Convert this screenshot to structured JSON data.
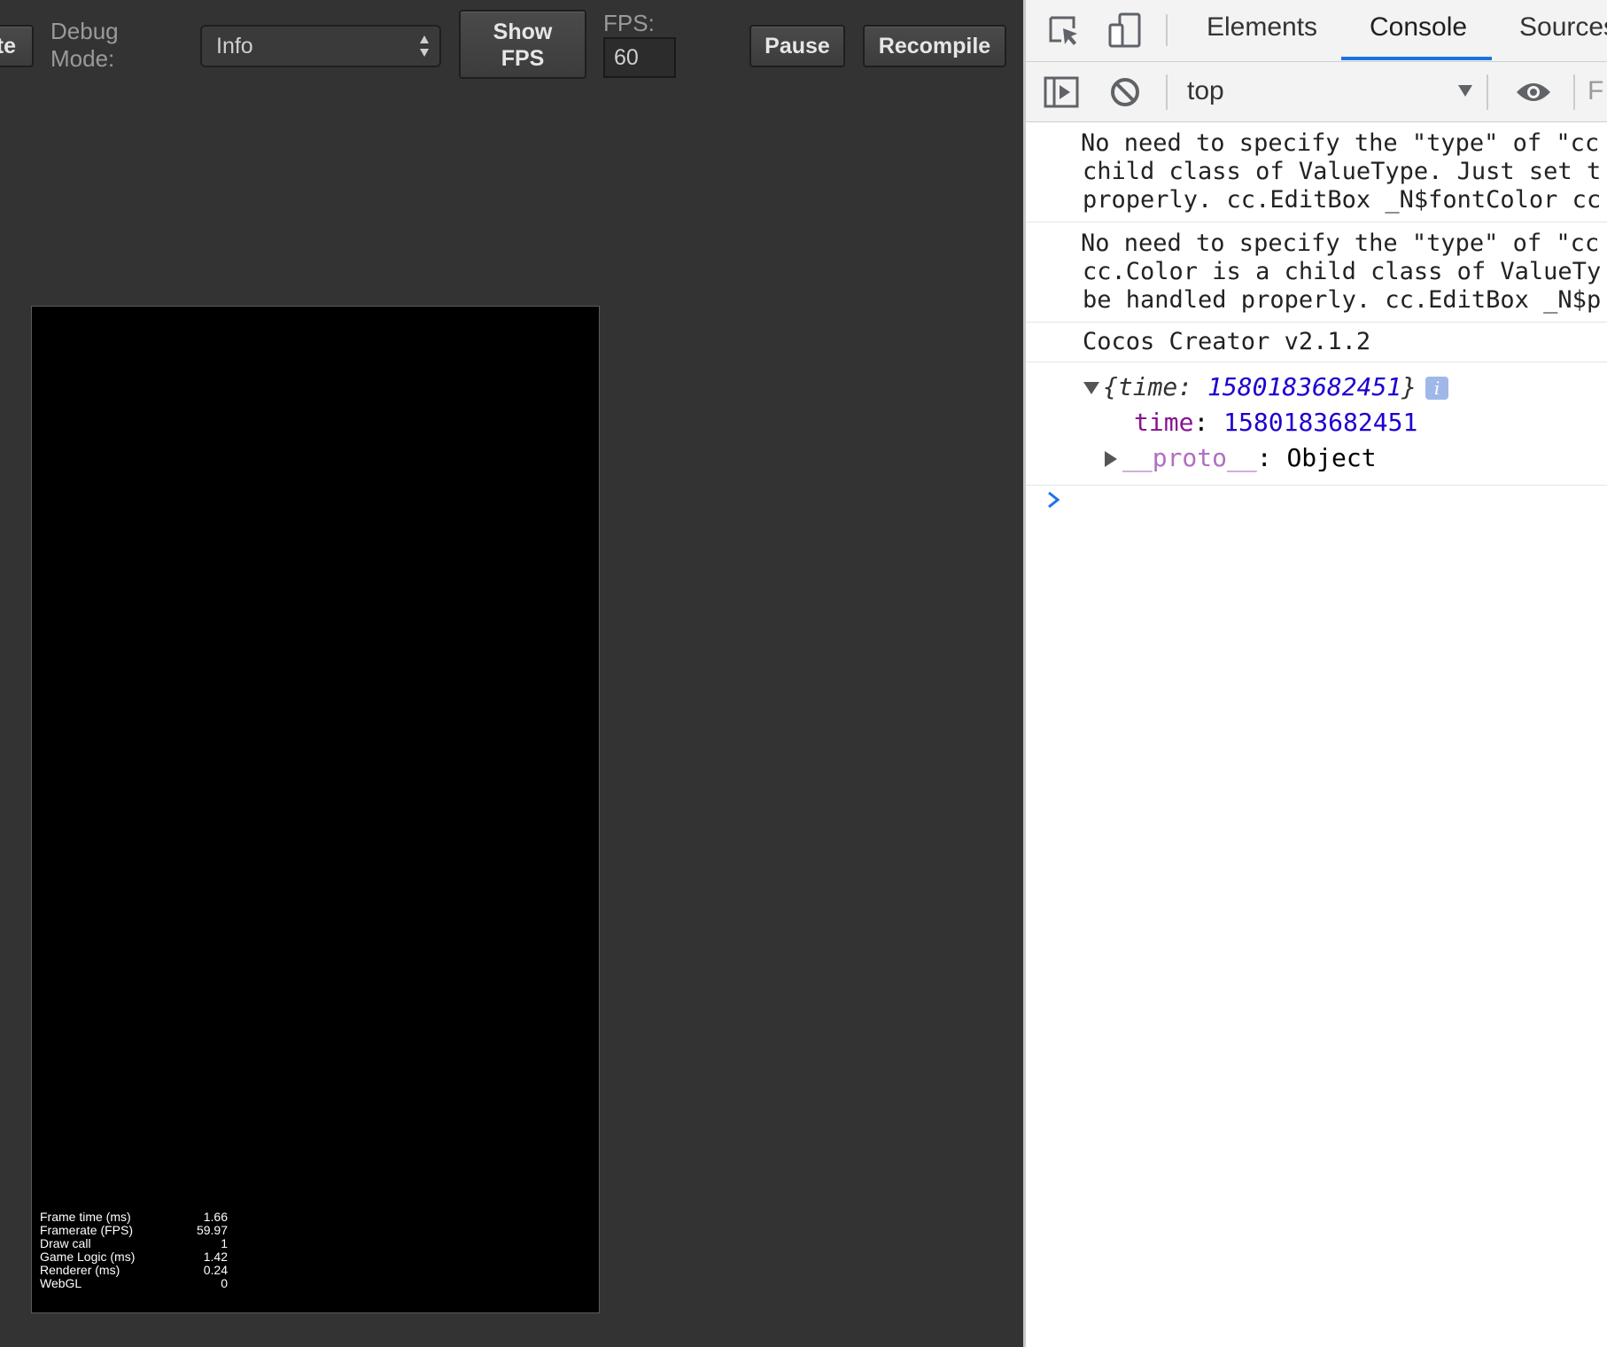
{
  "toolbar": {
    "cut_button_label": "te",
    "debug_mode_label_1": "Debug",
    "debug_mode_label_2": "Mode:",
    "debug_mode_value": "Info",
    "show_fps_label_1": "Show",
    "show_fps_label_2": "FPS",
    "fps_label": "FPS:",
    "fps_value": "60",
    "pause_label": "Pause",
    "recompile_label": "Recompile"
  },
  "stats": [
    {
      "label": "Frame time (ms)",
      "value": "1.66"
    },
    {
      "label": "Framerate (FPS)",
      "value": "59.97"
    },
    {
      "label": "Draw call",
      "value": "1"
    },
    {
      "label": "Game Logic (ms)",
      "value": "1.42"
    },
    {
      "label": "Renderer (ms)",
      "value": "0.24"
    },
    {
      "label": "WebGL",
      "value": "0"
    }
  ],
  "devtools": {
    "tabs": [
      "Elements",
      "Console",
      "Sources"
    ],
    "active_tab": "Console",
    "context": "top",
    "filter_cut": "F",
    "accent_color": "#1a73e8",
    "icons": [
      "inspect-element-icon",
      "device-toggle-icon",
      "sidebar-toggle-icon",
      "clear-console-icon",
      "dropdown-arrow-icon",
      "live-expression-eye-icon",
      "console-prompt-icon"
    ],
    "messages": [
      {
        "lines": [
          "No need to specify the \"type\" of \"cc",
          "child class of ValueType. Just set t",
          "properly. cc.EditBox _N$fontColor cc"
        ]
      },
      {
        "lines": [
          "No need to specify the \"type\" of \"cc",
          "cc.Color is a child class of ValueTy",
          "be handled properly. cc.EditBox _N$p"
        ]
      },
      {
        "lines": [
          "Cocos Creator v2.1.2"
        ]
      }
    ],
    "object": {
      "preview_key": "time",
      "preview_value": "1580183682451",
      "info_badge": "i",
      "prop_key": "time",
      "prop_value": "1580183682451",
      "proto_key": "__proto__",
      "proto_value": "Object"
    }
  }
}
